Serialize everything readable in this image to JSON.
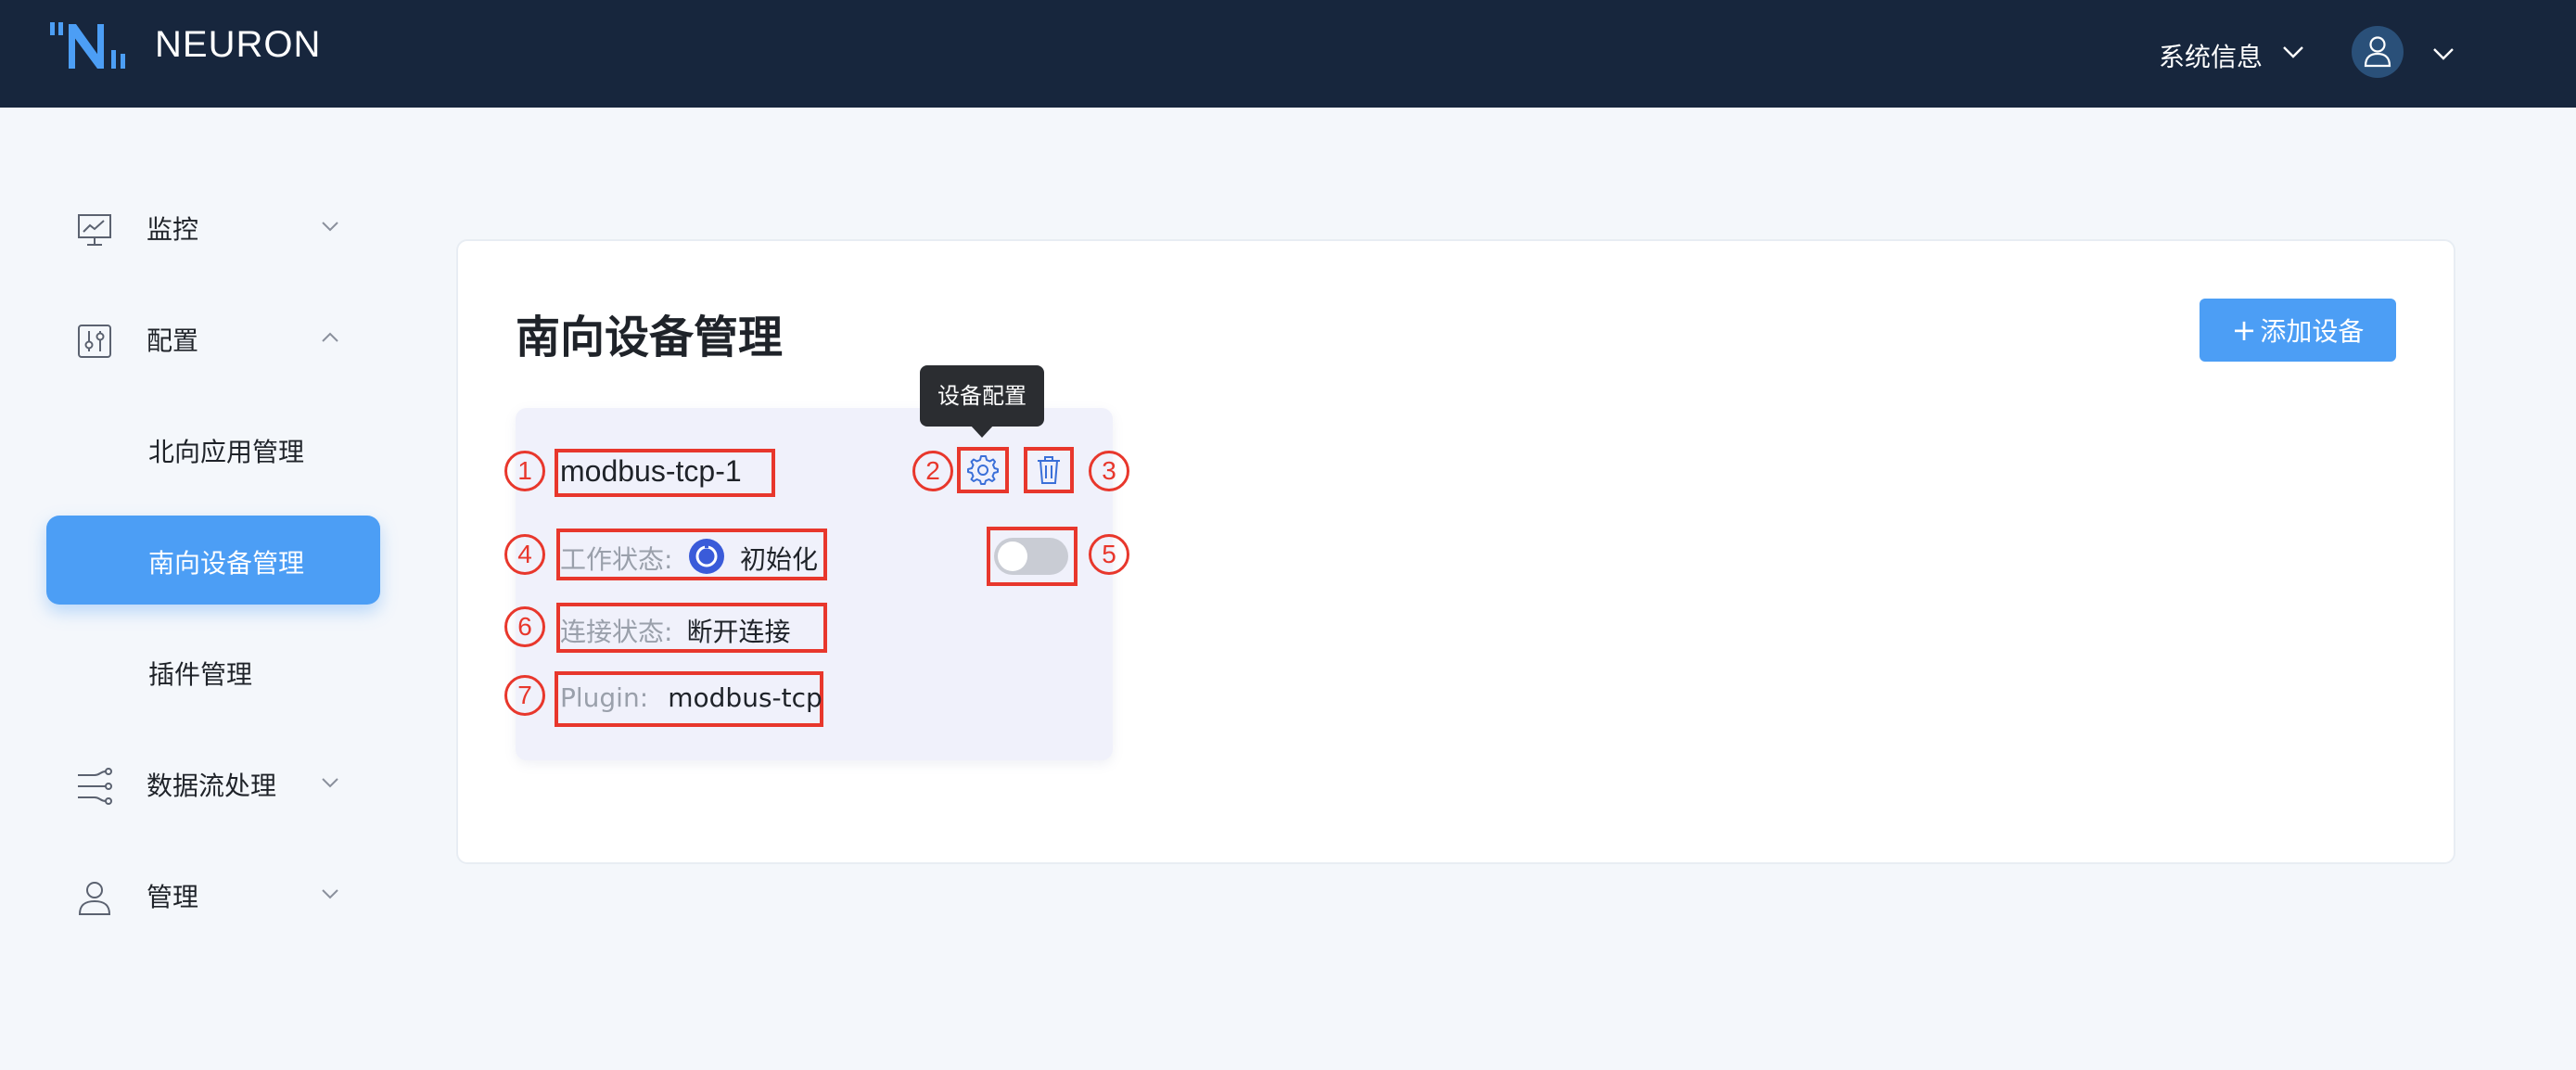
{
  "header": {
    "logo_text": "NEURON",
    "system_info_label": "系统信息"
  },
  "sidebar": {
    "items": [
      {
        "label": "监控",
        "icon": "monitor-icon",
        "expanded": false
      },
      {
        "label": "配置",
        "icon": "config-sliders-icon",
        "expanded": true
      },
      {
        "label": "北向应用管理",
        "sub": true
      },
      {
        "label": "南向设备管理",
        "sub": true,
        "active": true
      },
      {
        "label": "插件管理",
        "sub": true
      },
      {
        "label": "数据流处理",
        "icon": "data-flow-icon",
        "expanded": false
      },
      {
        "label": "管理",
        "icon": "user-icon",
        "expanded": false
      }
    ]
  },
  "main": {
    "title": "南向设备管理",
    "add_button_label": "添加设备"
  },
  "device_card": {
    "name": "modbus-tcp-1",
    "tooltip": "设备配置",
    "work_status_label": "工作状态:",
    "work_status_value": "初始化",
    "connection_status_label": "连接状态:",
    "connection_status_value": "断开连接",
    "plugin_label": "Plugin:",
    "plugin_value": "modbus-tcp",
    "toggle_on": false
  },
  "annotations": [
    "1",
    "2",
    "3",
    "4",
    "5",
    "6",
    "7"
  ],
  "colors": {
    "header_bg": "#17263d",
    "accent": "#4c9ef5",
    "annotation_red": "#e8372c",
    "status_blue": "#3a5bd9"
  }
}
